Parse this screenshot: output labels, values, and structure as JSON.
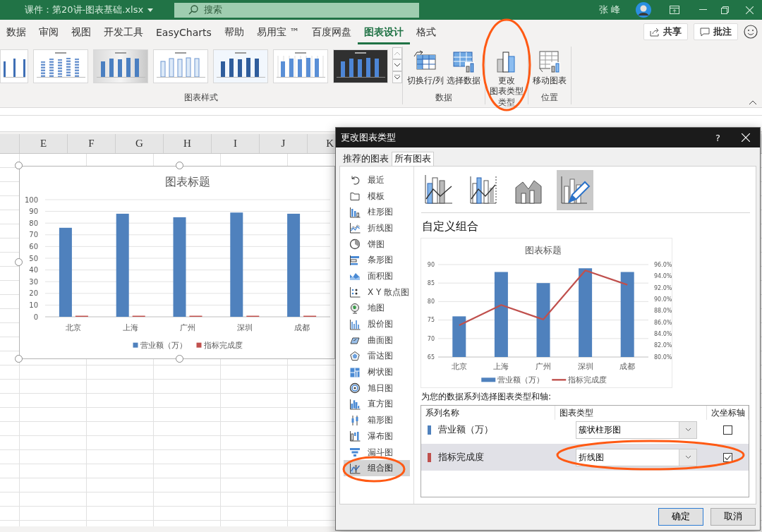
{
  "title_bar": {
    "document_title": "课件：第20讲-图表基础.xlsx",
    "search": {
      "placeholder": "搜索"
    },
    "user_name": "张 峰"
  },
  "ribbon_tabs": [
    {
      "label": "数据",
      "selected": false
    },
    {
      "label": "审阅",
      "selected": false
    },
    {
      "label": "视图",
      "selected": false
    },
    {
      "label": "开发工具",
      "selected": false
    },
    {
      "label": "EasyCharts",
      "selected": false
    },
    {
      "label": "帮助",
      "selected": false
    },
    {
      "label": "易用宝 ™",
      "selected": false
    },
    {
      "label": "百度网盘",
      "selected": false
    },
    {
      "label": "图表设计",
      "selected": true
    },
    {
      "label": "格式",
      "selected": false
    }
  ],
  "ribbon_actions": [
    {
      "label": "共享",
      "kind": "share"
    },
    {
      "label": "批注",
      "kind": "comment"
    }
  ],
  "ribbon": {
    "groups": [
      {
        "label": "图表样式",
        "kind": "gallery",
        "styles": [
          {
            "kind": "cut"
          },
          {
            "kind": "striped"
          },
          {
            "kind": "gray"
          },
          {
            "kind": "outlined"
          },
          {
            "kind": "blue"
          },
          {
            "kind": "hatched"
          },
          {
            "kind": "dark"
          }
        ]
      },
      {
        "label": "数据",
        "kind": "buttons",
        "buttons": [
          {
            "label": "切换行/列",
            "kind": "switch"
          },
          {
            "label": "选择数据",
            "kind": "select"
          }
        ]
      },
      {
        "label": "类型",
        "kind": "buttons",
        "buttons": [
          {
            "label_lines": [
              "更改",
              "图表类型"
            ],
            "kind": "change"
          }
        ]
      },
      {
        "label": "位置",
        "kind": "buttons",
        "buttons": [
          {
            "label": "移动图表",
            "kind": "move"
          }
        ]
      }
    ]
  },
  "sheet": {
    "columns": [
      "E",
      "F",
      "G",
      "H",
      "I",
      "J",
      "K"
    ]
  },
  "embedded_chart": {
    "selected": true,
    "chart_data": {
      "type": "bar",
      "title": "图表标题",
      "categories": [
        "北京",
        "上海",
        "广州",
        "深圳",
        "成都"
      ],
      "ylim": [
        0,
        100
      ],
      "yticks": [
        0,
        10,
        20,
        30,
        40,
        50,
        60,
        70,
        80,
        90,
        100
      ],
      "grid": true,
      "legend": true,
      "series": [
        {
          "name": "营业额（万）",
          "color": "#4f81bd",
          "values": [
            76,
            88,
            85,
            89,
            88
          ]
        },
        {
          "name": "指标完成度",
          "color": "#c0504d",
          "values": [
            0.9,
            0.9,
            0.9,
            0.9,
            0.9
          ]
        }
      ]
    }
  },
  "dialog": {
    "title": "更改图表类型",
    "help": "?",
    "tabs": [
      {
        "label": "推荐的图表",
        "selected": false
      },
      {
        "label": "所有图表",
        "selected": true
      }
    ],
    "chart_types": [
      {
        "label": "最近",
        "kind": "recent",
        "selected": false
      },
      {
        "label": "模板",
        "kind": "template",
        "selected": false
      },
      {
        "label": "柱形图",
        "kind": "column",
        "selected": false
      },
      {
        "label": "折线图",
        "kind": "line",
        "selected": false
      },
      {
        "label": "饼图",
        "kind": "pie",
        "selected": false
      },
      {
        "label": "条形图",
        "kind": "bar",
        "selected": false
      },
      {
        "label": "面积图",
        "kind": "area",
        "selected": false
      },
      {
        "label": "X Y 散点图",
        "kind": "scatter",
        "selected": false
      },
      {
        "label": "地图",
        "kind": "map",
        "selected": false
      },
      {
        "label": "股价图",
        "kind": "stock",
        "selected": false
      },
      {
        "label": "曲面图",
        "kind": "surface",
        "selected": false
      },
      {
        "label": "雷达图",
        "kind": "radar",
        "selected": false
      },
      {
        "label": "树状图",
        "kind": "treemap",
        "selected": false
      },
      {
        "label": "旭日图",
        "kind": "sunburst",
        "selected": false
      },
      {
        "label": "直方图",
        "kind": "histogram",
        "selected": false
      },
      {
        "label": "箱形图",
        "kind": "boxplot",
        "selected": false
      },
      {
        "label": "瀑布图",
        "kind": "waterfall",
        "selected": false
      },
      {
        "label": "漏斗图",
        "kind": "funnel",
        "selected": false
      },
      {
        "label": "组合图",
        "kind": "combo",
        "selected": true
      }
    ],
    "combo_subtypes": [
      {
        "kind": "clustered-line",
        "selected": false
      },
      {
        "kind": "clustered-line-secondary",
        "selected": false
      },
      {
        "kind": "area-clustered",
        "selected": false
      },
      {
        "kind": "custom",
        "selected": true
      }
    ],
    "heading": "自定义组合",
    "preview": {
      "chart_data": {
        "type": "bar",
        "title": "图表标题",
        "categories": [
          "北京",
          "上海",
          "广州",
          "深圳",
          "成都"
        ],
        "ylim": [
          65,
          90
        ],
        "yticks": [
          65,
          70,
          75,
          80,
          85,
          90
        ],
        "y2lim": [
          0.8,
          0.96
        ],
        "grid": true,
        "legend": true,
        "y2ticks": [
          {
            "value": 0.8,
            "label": "80.0%"
          },
          {
            "value": 0.82,
            "label": "82.0%"
          },
          {
            "value": 0.84,
            "label": "84.0%"
          },
          {
            "value": 0.86,
            "label": "86.0%"
          },
          {
            "value": 0.88,
            "label": "88.0%"
          },
          {
            "value": 0.9,
            "label": "90.0%"
          },
          {
            "value": 0.92,
            "label": "92.0%"
          },
          {
            "value": 0.94,
            "label": "94.0%"
          },
          {
            "value": 0.96,
            "label": "96.0%"
          }
        ],
        "series": [
          {
            "name": "营业额（万）",
            "color": "#4f81bd",
            "type": "bar",
            "values": [
              76,
              88,
              85,
              89,
              88
            ]
          },
          {
            "name": "指标完成度",
            "color": "#c0504d",
            "type": "line",
            "axis": "y2",
            "values": [
              0.855,
              0.89,
              0.865,
              0.95,
              0.925
            ]
          }
        ]
      }
    },
    "series_prompt": "为您的数据系列选择图表类型和轴:",
    "series_table": {
      "columns": [
        "系列名称",
        "图表类型",
        "次坐标轴"
      ],
      "rows": [
        {
          "name": "营业额（万）",
          "color": "#4f81bd",
          "chart_type": "簇状柱形图",
          "secondary_axis": false,
          "selected": false
        },
        {
          "name": "指标完成度",
          "color": "#c0504d",
          "chart_type": "折线图",
          "secondary_axis": true,
          "selected": true
        }
      ]
    },
    "buttons": [
      {
        "label": "确定",
        "default": true
      },
      {
        "label": "取消",
        "default": false
      }
    ]
  }
}
